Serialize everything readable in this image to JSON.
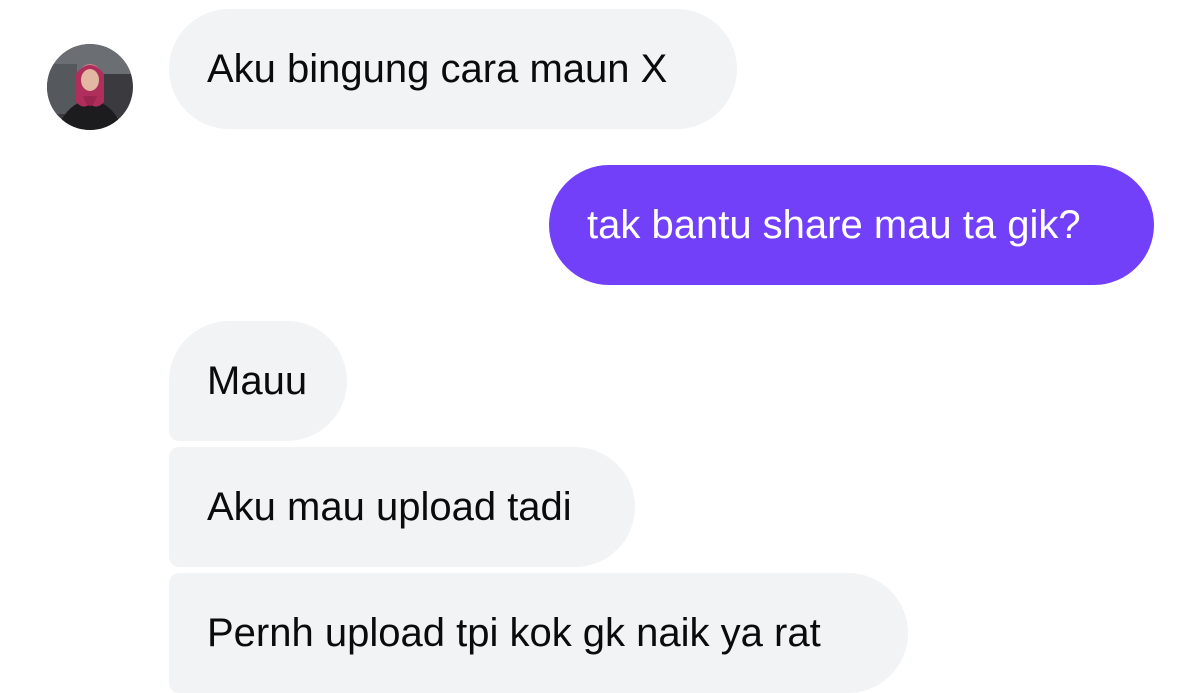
{
  "colors": {
    "incoming_bubble": "#f2f3f5",
    "outgoing_bubble": "#7340fa",
    "incoming_text": "#0b0b0c",
    "outgoing_text": "#ffffff"
  },
  "contact": {
    "avatar": "avatar-photo"
  },
  "messages": [
    {
      "sender": "contact",
      "text": "Aku bingung cara maun X"
    },
    {
      "sender": "me",
      "text": "tak bantu share mau ta gik?"
    },
    {
      "sender": "contact",
      "text": "Mauu"
    },
    {
      "sender": "contact",
      "text": "Aku mau upload tadi"
    },
    {
      "sender": "contact",
      "text": "Pernh upload tpi kok gk naik ya rat"
    }
  ]
}
